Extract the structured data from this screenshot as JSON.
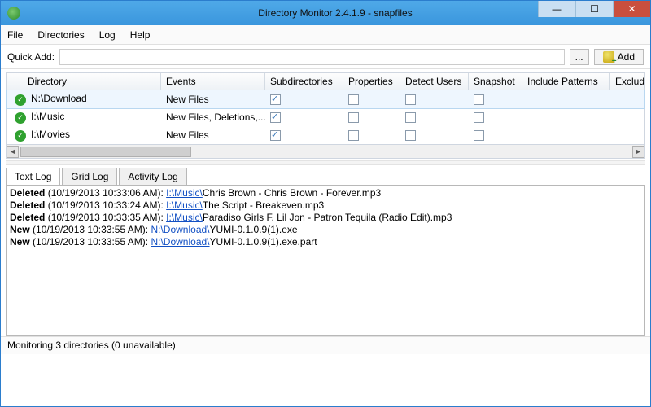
{
  "title": "Directory Monitor 2.4.1.9 - snapfiles",
  "menu": {
    "file": "File",
    "directories": "Directories",
    "log": "Log",
    "help": "Help"
  },
  "quickadd": {
    "label": "Quick Add:",
    "value": "",
    "browse": "...",
    "add": "Add"
  },
  "columns": {
    "dir": "Directory",
    "ev": "Events",
    "sub": "Subdirectories",
    "prop": "Properties",
    "det": "Detect Users",
    "snap": "Snapshot",
    "inc": "Include Patterns",
    "exc": "Exclude Pattern"
  },
  "rows": [
    {
      "dir": "N:\\Download",
      "events": "New Files",
      "sub": true,
      "prop": false,
      "det": false,
      "snap": false,
      "selected": true
    },
    {
      "dir": "I:\\Music",
      "events": "New Files, Deletions,...",
      "sub": true,
      "prop": false,
      "det": false,
      "snap": false,
      "selected": false
    },
    {
      "dir": "I:\\Movies",
      "events": "New Files",
      "sub": true,
      "prop": false,
      "det": false,
      "snap": false,
      "selected": false
    }
  ],
  "tabs": {
    "text": "Text Log",
    "grid": "Grid Log",
    "activity": "Activity Log"
  },
  "log": [
    {
      "action": "Deleted",
      "ts": "10/19/2013 10:33:06 AM",
      "path": "I:\\Music\\",
      "file": "Chris Brown - Chris Brown - Forever.mp3"
    },
    {
      "action": "Deleted",
      "ts": "10/19/2013 10:33:24 AM",
      "path": "I:\\Music\\",
      "file": "The Script - Breakeven.mp3"
    },
    {
      "action": "Deleted",
      "ts": "10/19/2013 10:33:35 AM",
      "path": "I:\\Music\\",
      "file": "Paradiso Girls F. Lil Jon - Patron Tequila (Radio Edit).mp3"
    },
    {
      "action": "New",
      "ts": "10/19/2013 10:33:55 AM",
      "path": "N:\\Download\\",
      "file": "YUMI-0.1.0.9(1).exe"
    },
    {
      "action": "New",
      "ts": "10/19/2013 10:33:55 AM",
      "path": "N:\\Download\\",
      "file": "YUMI-0.1.0.9(1).exe.part"
    }
  ],
  "status": "Monitoring 3 directories (0 unavailable)"
}
